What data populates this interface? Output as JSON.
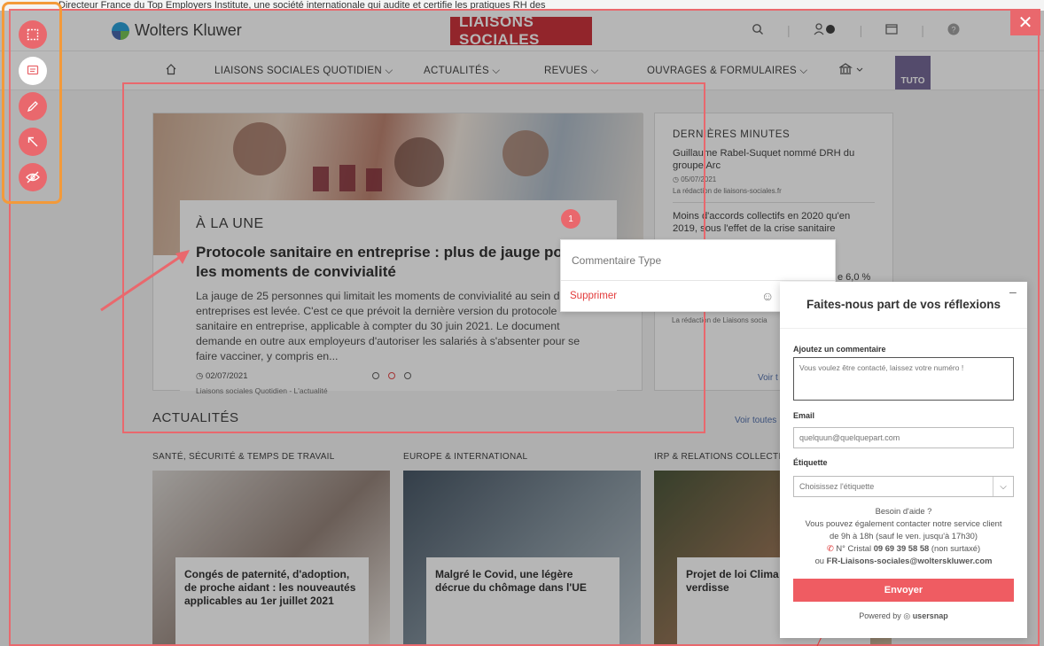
{
  "topline": "Directeur France du Top Employers Institute, une société internationale qui audite et certifie les pratiques RH des",
  "header": {
    "brand_wk": "Wolters Kluwer",
    "brand_ls": "LIAISONS SOCIALES",
    "close": "✕",
    "icons": [
      "search-icon",
      "user-icon",
      "folder-icon",
      "help-icon"
    ]
  },
  "nav": {
    "items": [
      {
        "label": "LIAISONS SOCIALES QUOTIDIEN"
      },
      {
        "label": "ACTUALITÉS"
      },
      {
        "label": "REVUES"
      },
      {
        "label": "OUVRAGES & FORMULAIRES"
      }
    ],
    "tuto": "TUTO"
  },
  "hero": {
    "kicker": "À LA UNE",
    "title": "Protocole sanitaire en entreprise : plus de jauge pour les moments de convivialité",
    "text": "La jauge de 25 personnes qui limitait les moments de convivialité au sein des entreprises est levée. C'est ce que prévoit la dernière version du protocole sanitaire en entreprise, applicable à compter du 30 juin 2021. Le document demande en outre aux employeurs d'autoriser les salariés à s'absenter pour se faire vacciner, y compris en...",
    "date": "02/07/2021",
    "source": "Liaisons sociales Quotidien - L'actualité"
  },
  "side": {
    "title": "DERNIÈRES MINUTES",
    "item1": "Guillaume Rabel-Suquet nommé DRH du groupe Arc",
    "item1_date": "05/07/2021",
    "item1_src": "La rédaction de liaisons-sociales.fr",
    "item2": "Moins d'accords collectifs en 2020 qu'en 2019, sous l'effet de la crise sanitaire",
    "extra1": "e 6,0 %",
    "extra2": "La rédaction de Liaisons socia",
    "voir": "Voir t"
  },
  "actualites": {
    "heading": "ACTUALITÉS",
    "voir": "Voir toutes",
    "cats": [
      "SANTÉ, SÉCURITÉ & TEMPS DE TRAVAIL",
      "EUROPE & INTERNATIONAL",
      "IRP & RELATIONS COLLECTIVE"
    ],
    "cards": [
      "Congés de paternité, d'adoption, de proche aidant : les nouveautés applicables au 1er juillet 2021",
      "Malgré le Covid, une légère décrue du chômage dans l'UE",
      "Projet de loi Clima rejette le verdisse"
    ]
  },
  "annotation": {
    "badge": "1",
    "comment_placeholder": "Commentaire Type",
    "delete": "Supprimer"
  },
  "feedback": {
    "minimize": "–",
    "title": "Faites-nous part de vos réflexions",
    "comment_label": "Ajoutez un commentaire",
    "comment_placeholder": "Vous voulez être contacté, laissez votre numéro !",
    "email_label": "Email",
    "email_placeholder": "quelquun@quelquepart.com",
    "tag_label": "Étiquette",
    "tag_placeholder": "Choisissez l'étiquette",
    "help_title": "Besoin d'aide ?",
    "help_line1": "Vous pouvez également contacter notre service client",
    "help_line2": "de 9h à 18h (sauf le ven. jusqu'à 17h30)",
    "help_phone_prefix": "N° Cristal",
    "help_phone": "09 69 39 58 58",
    "help_phone_suffix": "(non surtaxé)",
    "help_mail_prefix": "ou",
    "help_mail": "FR-Liaisons-sociales@wolterskluwer.com",
    "send": "Envoyer",
    "powered_prefix": "Powered by",
    "powered_brand": "usersnap"
  },
  "colors": {
    "accent": "#e9686d",
    "highlight_toolbar": "#f39a3a",
    "brand_red": "#c8232c",
    "link": "#4666a6"
  }
}
